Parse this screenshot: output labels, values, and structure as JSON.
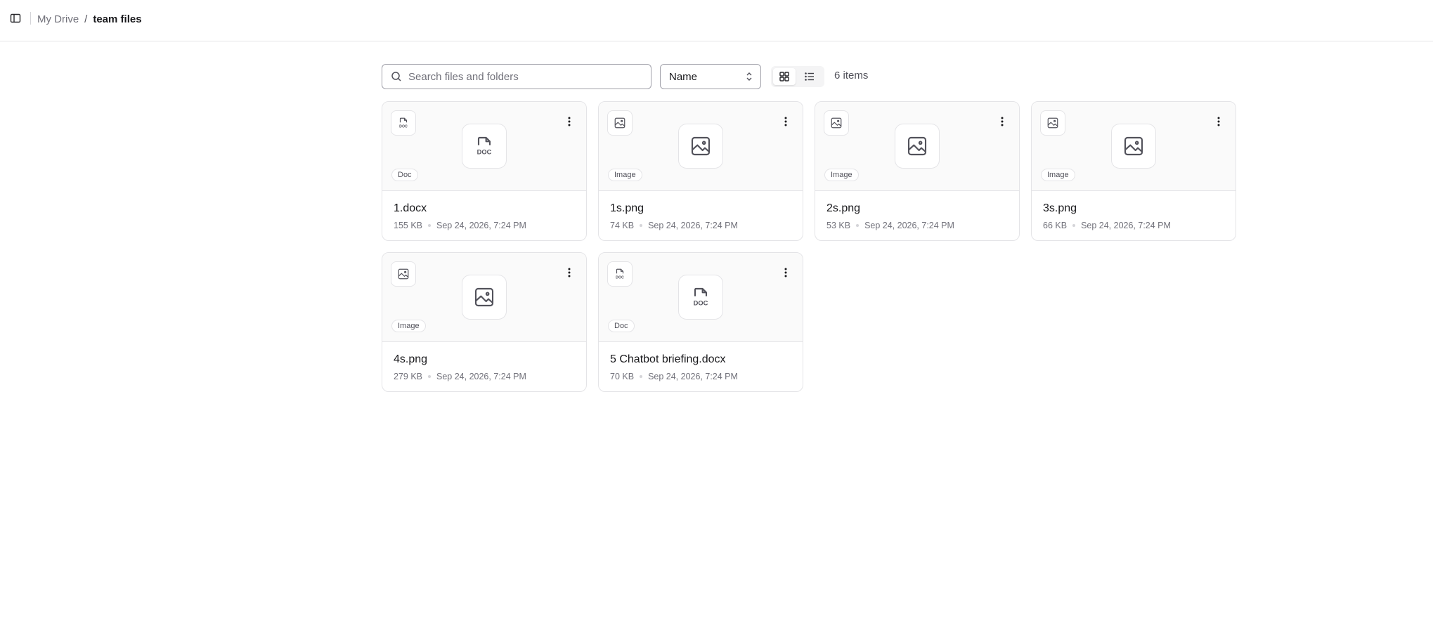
{
  "header": {
    "sidebar_toggle_icon": "sidebar-icon",
    "breadcrumb": {
      "root": "My Drive",
      "separator": "/",
      "current": "team files"
    }
  },
  "toolbar": {
    "search": {
      "placeholder": "Search files and folders",
      "value": ""
    },
    "sort": {
      "value": "Name"
    },
    "view_modes": [
      "grid",
      "list"
    ],
    "active_view": "grid",
    "item_count": "6 items"
  },
  "files": [
    {
      "name": "1.docx",
      "type_label": "Doc",
      "icon": "doc-icon",
      "size": "155 KB",
      "modified": "Sep 24, 2026, 7:24 PM"
    },
    {
      "name": "1s.png",
      "type_label": "Image",
      "icon": "image-icon",
      "size": "74 KB",
      "modified": "Sep 24, 2026, 7:24 PM"
    },
    {
      "name": "2s.png",
      "type_label": "Image",
      "icon": "image-icon",
      "size": "53 KB",
      "modified": "Sep 24, 2026, 7:24 PM"
    },
    {
      "name": "3s.png",
      "type_label": "Image",
      "icon": "image-icon",
      "size": "66 KB",
      "modified": "Sep 24, 2026, 7:24 PM"
    },
    {
      "name": "4s.png",
      "type_label": "Image",
      "icon": "image-icon",
      "size": "279 KB",
      "modified": "Sep 24, 2026, 7:24 PM"
    },
    {
      "name": "5 Chatbot briefing.docx",
      "type_label": "Doc",
      "icon": "doc-icon",
      "size": "70 KB",
      "modified": "Sep 24, 2026, 7:24 PM"
    }
  ],
  "colors": {
    "border": "#e4e4e7",
    "text_primary": "#18181b",
    "text_muted": "#71717a",
    "preview_bg": "#fafafa"
  }
}
